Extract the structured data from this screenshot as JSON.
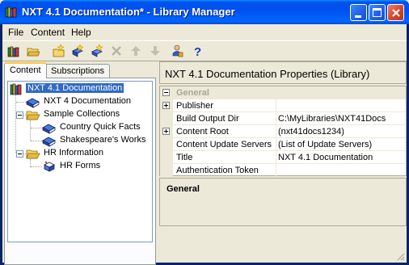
{
  "window": {
    "title": "NXT 4.1 Documentation* - Library Manager"
  },
  "menu": {
    "items": [
      "File",
      "Content",
      "Help"
    ]
  },
  "toolbar": {
    "buttons": [
      "open-library-icon",
      "open-folder-icon",
      "new-content-icon",
      "new-collection-icon",
      "new-item-icon",
      "delete-icon",
      "move-up-icon",
      "move-down-icon",
      "permissions-icon",
      "help-icon"
    ]
  },
  "tabs": [
    "Content",
    "Subscriptions"
  ],
  "tree": {
    "nodes": [
      {
        "label": "NXT 4.1 Documentation",
        "icon": "library-icon",
        "selected": true
      },
      {
        "label": "NXT 4 Documentation",
        "icon": "book-icon"
      },
      {
        "label": "Sample Collections",
        "icon": "folder-icon"
      },
      {
        "label": "Country Quick Facts",
        "icon": "book-icon"
      },
      {
        "label": "Shakespeare's Works",
        "icon": "book-icon"
      },
      {
        "label": "HR Information",
        "icon": "folder-icon"
      },
      {
        "label": "HR Forms",
        "icon": "form-icon"
      }
    ]
  },
  "properties": {
    "title": "NXT 4.1 Documentation Properties (Library)",
    "category": "General",
    "rows": [
      {
        "name": "Publisher",
        "value": ""
      },
      {
        "name": "Build Output Dir",
        "value": "C:\\MyLibraries\\NXT41Docs"
      },
      {
        "name": "Content Root",
        "value": "(nxt41docs1234)"
      },
      {
        "name": "Content Update Servers",
        "value": "(List of Update Servers)"
      },
      {
        "name": "Title",
        "value": "NXT 4.1 Documentation"
      },
      {
        "name": "Authentication Token",
        "value": ""
      }
    ],
    "description_title": "General"
  }
}
